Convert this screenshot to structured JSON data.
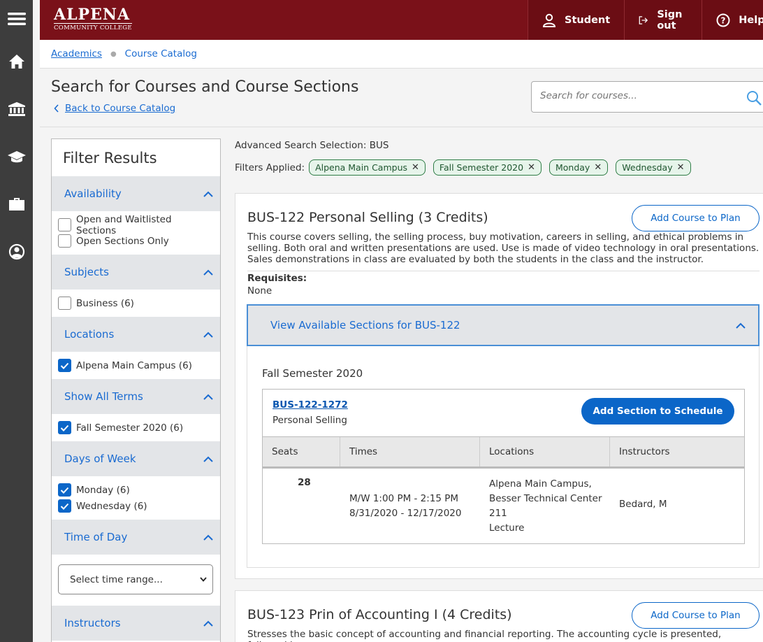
{
  "header": {
    "logo_line1": "ALPENA",
    "logo_line2": "COMMUNITY COLLEGE",
    "nav": [
      {
        "label": "Student",
        "icon": "user-icon"
      },
      {
        "label": "Sign out",
        "icon": "sign-out-icon"
      },
      {
        "label": "Help",
        "icon": "help-icon"
      }
    ]
  },
  "rail": {
    "icons": [
      "menu-icon",
      "home-icon",
      "institution-icon",
      "graduation-cap-icon",
      "briefcase-icon",
      "user-circle-icon"
    ]
  },
  "breadcrumb": {
    "item1": "Academics",
    "item2": "Course Catalog"
  },
  "page": {
    "title": "Search for Courses and Course Sections",
    "back_link": "Back to Course Catalog",
    "search_placeholder": "Search for courses..."
  },
  "filters": {
    "title": "Filter Results",
    "availability": {
      "header": "Availability",
      "options": [
        "Open and Waitlisted Sections",
        "Open Sections Only"
      ]
    },
    "subjects": {
      "header": "Subjects",
      "options": [
        "Business (6)"
      ]
    },
    "locations": {
      "header": "Locations",
      "options": [
        "Alpena Main Campus (6)"
      ]
    },
    "terms": {
      "header": "Show All Terms",
      "options": [
        "Fall Semester 2020 (6)"
      ]
    },
    "days": {
      "header": "Days of Week",
      "options": [
        "Monday (6)",
        "Wednesday (6)"
      ]
    },
    "time_of_day": {
      "header": "Time of Day",
      "select_value": "Select time range..."
    },
    "instructors": {
      "header": "Instructors"
    }
  },
  "results": {
    "advanced_selection": "Advanced Search Selection: BUS",
    "filters_applied_label": "Filters Applied:",
    "chips": [
      "Alpena Main Campus",
      "Fall Semester 2020",
      "Monday",
      "Wednesday"
    ],
    "courses": [
      {
        "title": "BUS-122 Personal Selling (3 Credits)",
        "add_label": "Add Course to Plan",
        "description": "This course covers selling, the selling process, buy motivation, careers in selling, and ethical problems in selling. Both oral and written presentations are used. Use is made of video technology in oral presentations. Sales demonstrations in class are evaluated by both the students in the class and the instructor.",
        "requisites_label": "Requisites:",
        "requisites_value": "None",
        "sections_toggle": "View Available Sections for BUS-122",
        "term": "Fall Semester 2020",
        "section": {
          "code": "BUS-122-1272",
          "name": "Personal Selling",
          "add_label": "Add Section to Schedule",
          "columns": [
            "Seats",
            "Times",
            "Locations",
            "Instructors"
          ],
          "seats": "28",
          "times_line1": "M/W 1:00 PM - 2:15 PM",
          "times_line2": "8/31/2020 - 12/17/2020",
          "loc_line1": "Alpena Main Campus,",
          "loc_line2": "Besser Technical Center",
          "loc_line3": "211",
          "loc_line4": "Lecture",
          "instructor": "Bedard, M"
        }
      },
      {
        "title": "BUS-123 Prin of Accounting I (4 Credits)",
        "add_label": "Add Course to Plan",
        "description": "Stresses the basic concept of accounting and financial reporting. The accounting cycle is presented, followed by"
      }
    ]
  },
  "colors": {
    "brand": "#7a1119",
    "accent": "#0b66c8",
    "chip": "#e6f4ea"
  }
}
